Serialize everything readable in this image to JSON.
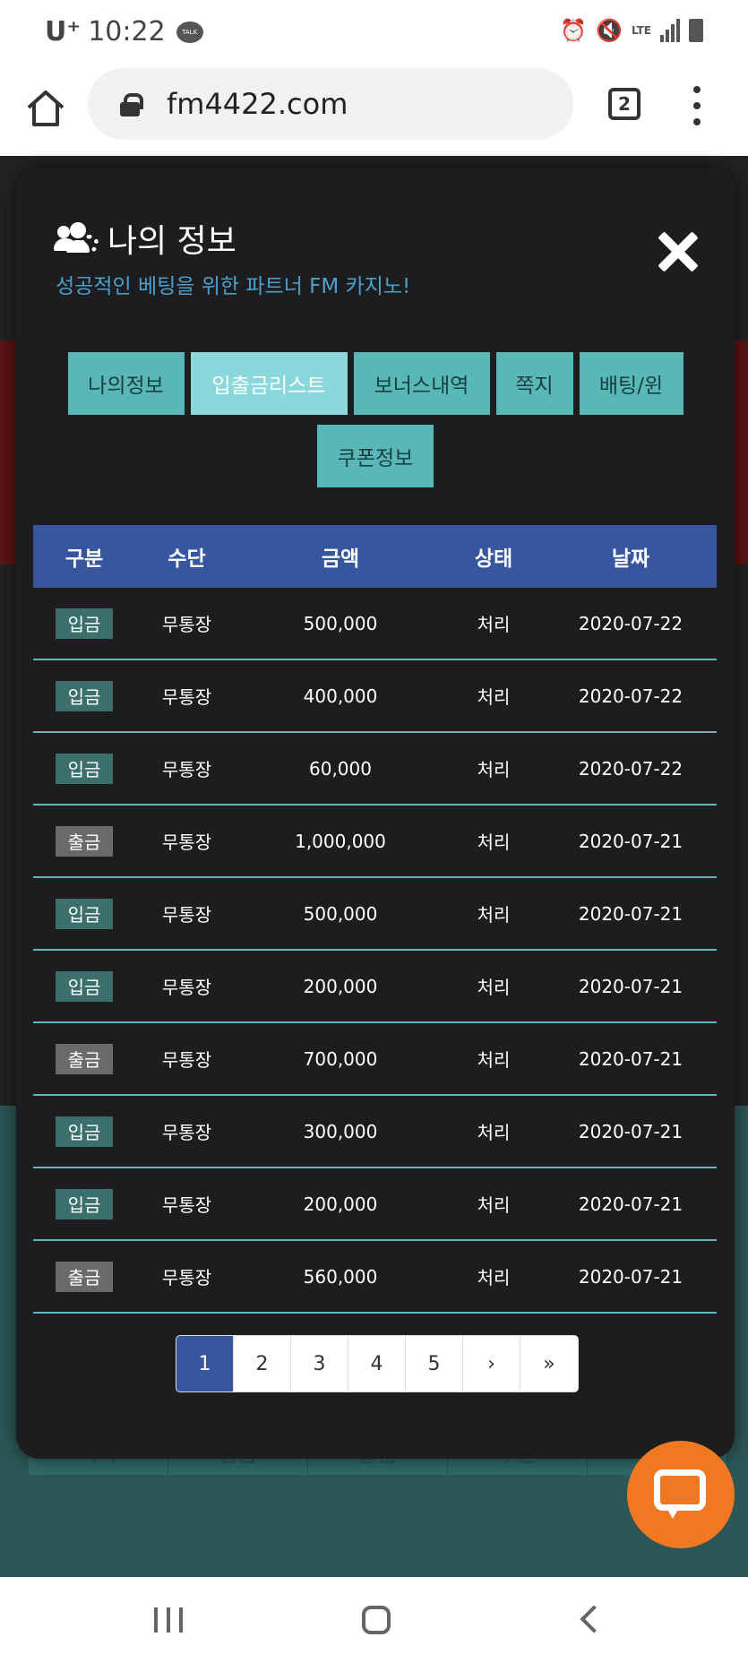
{
  "statusbar": {
    "carrier": "U⁺",
    "time": "10:22",
    "talk": "TALK",
    "lte": "LTE"
  },
  "browser": {
    "url": "fm4422.com",
    "tab_count": "2"
  },
  "modal": {
    "title": "나의 정보",
    "subtitle": "성공적인 베팅을 위한 파트너 FM 카지노!",
    "tabs": [
      {
        "label": "나의정보",
        "active": false
      },
      {
        "label": "입출금리스트",
        "active": true
      },
      {
        "label": "보너스내역",
        "active": false
      },
      {
        "label": "쪽지",
        "active": false
      },
      {
        "label": "배팅/윈",
        "active": false
      },
      {
        "label": "쿠폰정보",
        "active": false
      }
    ]
  },
  "table": {
    "headers": [
      "구분",
      "수단",
      "금액",
      "상태",
      "날짜"
    ],
    "rows": [
      {
        "type": "입금",
        "method": "무통장",
        "amount": "500,000",
        "status": "처리",
        "date": "2020-07-22"
      },
      {
        "type": "입금",
        "method": "무통장",
        "amount": "400,000",
        "status": "처리",
        "date": "2020-07-22"
      },
      {
        "type": "입금",
        "method": "무통장",
        "amount": "60,000",
        "status": "처리",
        "date": "2020-07-22"
      },
      {
        "type": "출금",
        "method": "무통장",
        "amount": "1,000,000",
        "status": "처리",
        "date": "2020-07-21"
      },
      {
        "type": "입금",
        "method": "무통장",
        "amount": "500,000",
        "status": "처리",
        "date": "2020-07-21"
      },
      {
        "type": "입금",
        "method": "무통장",
        "amount": "200,000",
        "status": "처리",
        "date": "2020-07-21"
      },
      {
        "type": "출금",
        "method": "무통장",
        "amount": "700,000",
        "status": "처리",
        "date": "2020-07-21"
      },
      {
        "type": "입금",
        "method": "무통장",
        "amount": "300,000",
        "status": "처리",
        "date": "2020-07-21"
      },
      {
        "type": "입금",
        "method": "무통장",
        "amount": "200,000",
        "status": "처리",
        "date": "2020-07-21"
      },
      {
        "type": "출금",
        "method": "무통장",
        "amount": "560,000",
        "status": "처리",
        "date": "2020-07-21"
      }
    ]
  },
  "pagination": {
    "pages": [
      "1",
      "2",
      "3",
      "4",
      "5",
      "›",
      "»"
    ],
    "current": "1"
  },
  "colors": {
    "deposit_badge": "#3a6f6b",
    "withdraw_badge": "#6a6a6a",
    "header": "#3656a0",
    "tab": "#58b7b7",
    "tab_active": "#8ad8dc",
    "chat_fab": "#f07820"
  },
  "background_nav": [
    "쪽지",
    "입금",
    "출금",
    "쿠폰",
    "보"
  ]
}
